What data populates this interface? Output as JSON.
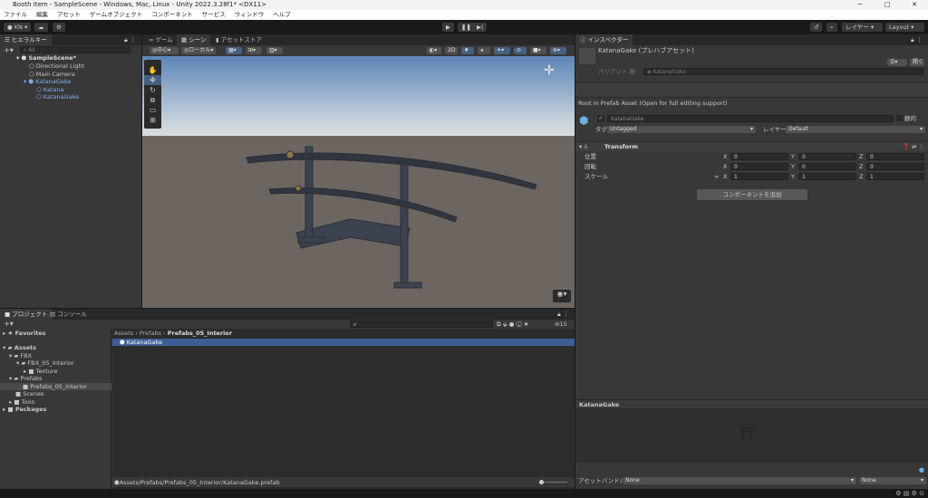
{
  "window": {
    "title": "Booth Item - SampleScene - Windows, Mac, Linux - Unity 2022.3.28f1* <DX11>",
    "controls": [
      "─",
      "□",
      "✕"
    ]
  },
  "menu": [
    "ファイル",
    "編集",
    "アセット",
    "ゲームオブジェクト",
    "コンポーネント",
    "サービス",
    "ウィンドウ",
    "ヘルプ"
  ],
  "toolbar": {
    "account": "KN ▾",
    "layers": "レイヤー",
    "layout": "Layout"
  },
  "hierarchy": {
    "tab": "ヒエラルキー",
    "search_placeholder": "All",
    "items": [
      "SampleScene*",
      "Directional Light",
      "Main Camera",
      "KatanaGake",
      "Katana",
      "KatanaGake"
    ]
  },
  "scene": {
    "tabs": [
      "ゲーム",
      "シーン",
      "アセットストア"
    ],
    "pivot": "中心",
    "space": "ローカル",
    "mode2d": "2D"
  },
  "project": {
    "tabs": [
      "プロジェクト",
      "コンソール"
    ],
    "hidden_count": "15",
    "breadcrumb": [
      "Assets",
      "Prefabs",
      "Prefabs_05_Interior"
    ],
    "tree": [
      "Favorites",
      "Assets",
      "FBX",
      "FBX_05_Interior",
      "Texture",
      "Prefabs",
      "Prefabs_05_Interior",
      "Scenes",
      "Toon",
      "Packages"
    ],
    "files": [
      "KatanaGake"
    ],
    "path": "Assets/Prefabs/Prefabs_05_Interior/KatanaGake.prefab"
  },
  "inspector": {
    "tab": "インスペクター",
    "title": "KatanaGake (プレハブアセット)",
    "open_button": "開く",
    "variant_label": "バリアント 親",
    "variant_value": "KatanaGake",
    "notice": "Root in Prefab Asset (Open for full editing support)",
    "name": "KatanaGake",
    "static_label": "静的",
    "tag_label": "タグ",
    "tag": "Untagged",
    "layer_label": "レイヤー",
    "layer": "Default",
    "transform": {
      "title": "Transform",
      "rows": [
        {
          "label": "位置",
          "x": "0",
          "y": "0",
          "z": "0"
        },
        {
          "label": "回転",
          "x": "0",
          "y": "0",
          "z": "0"
        },
        {
          "label": "スケール",
          "x": "1",
          "y": "1",
          "z": "1"
        }
      ]
    },
    "add_component": "コンポーネントを追加",
    "preview_title": "KatanaGake",
    "bundle_label": "アセットバンドル",
    "bundle": "None",
    "variant": "None"
  }
}
